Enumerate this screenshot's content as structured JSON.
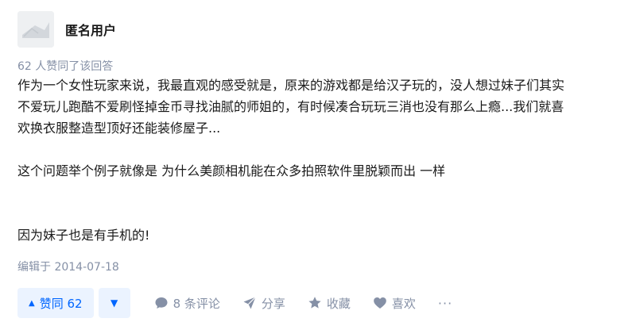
{
  "author": {
    "name": "匿名用户"
  },
  "votes_line": "62 人赞同了该回答",
  "content": {
    "para1_line1": "作为一个女性玩家来说，我最直观的感受就是，原来的游戏都是给汉子玩的，没人想过妹子们其实",
    "para1_line2": "不爱玩儿跑酷不爱刷怪掉金币寻找油腻的师姐的，有时候凑合玩玩三消也没有那么上瘾...我们就喜",
    "para1_line3": "欢换衣服整造型顶好还能装修屋子...",
    "para2": "这个问题举个例子就像是 为什么美颜相机能在众多拍照软件里脱颖而出 一样",
    "para3": "因为妹子也是有手机的!"
  },
  "edited": "编辑于 2014-07-18",
  "actions": {
    "vote_up_label": "赞同 62",
    "comments_label": "8 条评论",
    "share_label": "分享",
    "favorite_label": "收藏",
    "like_label": "喜欢",
    "more_label": "···"
  },
  "icons": [
    "anonymous-avatar-icon",
    "vote-up-triangle-icon",
    "vote-down-triangle-icon",
    "comment-icon",
    "share-icon",
    "star-icon",
    "heart-icon",
    "more-icon"
  ],
  "colors": {
    "accent": "#0066ff",
    "accent_bg": "#ebf3ff",
    "meta_gray": "#8590a6",
    "text": "#1a1a1a"
  }
}
